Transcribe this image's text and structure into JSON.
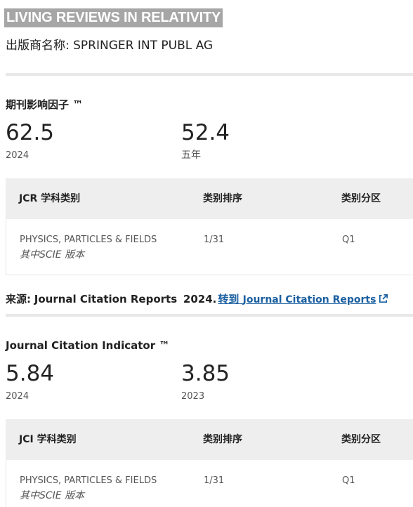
{
  "journal": {
    "title": "LIVING REVIEWS IN RELATIVITY",
    "publisher_label": "出版商名称:",
    "publisher_name": "SPRINGER INT PUBL AG"
  },
  "impact_factor": {
    "heading": "期刊影响因子 ™",
    "current_value": "62.5",
    "current_label": "2024",
    "five_year_value": "52.4",
    "five_year_label": "五年",
    "table": {
      "headers": [
        "JCR 学科类别",
        "类别排序",
        "类别分区"
      ],
      "rows": [
        {
          "category": "PHYSICS, PARTICLES & FIELDS",
          "edition": "其中SCIE 版本",
          "rank": "1/31",
          "quartile": "Q1"
        }
      ]
    }
  },
  "source": {
    "label": "来源:",
    "text": "Journal Citation Reports",
    "year": "2024.",
    "link_prefix": "转到",
    "link_text": "Journal Citation Reports"
  },
  "jci": {
    "heading": "Journal Citation Indicator ™",
    "current_value": "5.84",
    "current_label": "2024",
    "prev_value": "3.85",
    "prev_label": "2023",
    "table": {
      "headers": [
        "JCI 学科类别",
        "类别排序",
        "类别分区"
      ],
      "rows": [
        {
          "category": "PHYSICS, PARTICLES & FIELDS",
          "edition": "其中SCIE 版本",
          "rank": "1/31",
          "quartile": "Q1"
        }
      ]
    }
  },
  "colors": {
    "title_bg": "#a6a6a6",
    "link": "#1a5fa0",
    "table_header_bg": "#eeeeee",
    "divider": "#e8e8e8"
  },
  "icons": {
    "external_link": "external-link-icon"
  }
}
